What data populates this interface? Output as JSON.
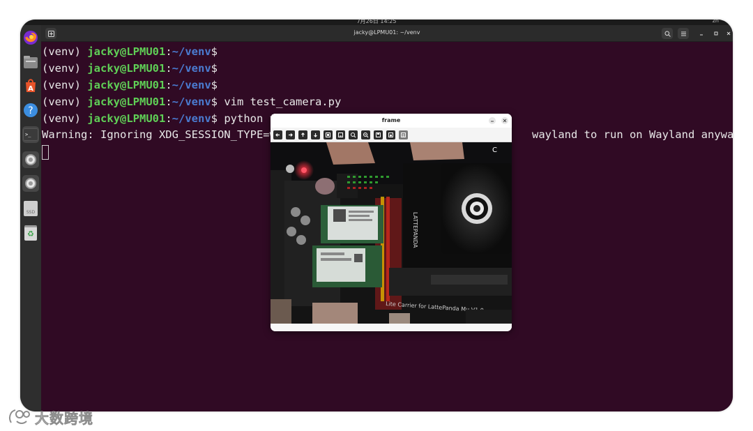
{
  "topbar": {
    "clock": "7月26日 14:25",
    "system": "zh"
  },
  "dock": {
    "items": [
      {
        "name": "firefox",
        "icon": "firefox-icon"
      },
      {
        "name": "files",
        "icon": "folder-icon"
      },
      {
        "name": "software",
        "icon": "app-center-icon"
      },
      {
        "name": "help",
        "icon": "help-icon",
        "glyph": "?"
      },
      {
        "name": "terminal",
        "icon": "terminal-icon",
        "glyph": ">_"
      },
      {
        "name": "settings-1",
        "icon": "gear-icon"
      },
      {
        "name": "settings-2",
        "icon": "gear-icon"
      },
      {
        "name": "ssd",
        "icon": "drive-icon",
        "label": "SSD"
      },
      {
        "name": "trash",
        "icon": "trash-icon",
        "glyph": "♻"
      }
    ]
  },
  "terminal": {
    "title": "jacky@LPMU01: ~/venv",
    "prompt": {
      "venv": "(venv) ",
      "user": "jacky@LPMU01",
      "colon": ":",
      "path": "~/venv",
      "dollar": "$"
    },
    "lines": [
      {
        "cmd": ""
      },
      {
        "cmd": ""
      },
      {
        "cmd": ""
      },
      {
        "cmd": " vim test_camera.py"
      },
      {
        "cmd": " python t"
      }
    ],
    "warning_left": "Warning: Ignoring XDG_SESSION_TYPE=w",
    "warning_right": "wayland to run on Wayland anyway."
  },
  "frame_window": {
    "title": "frame",
    "tools": [
      "home-icon",
      "back-icon",
      "forward-icon",
      "pan-icon",
      "zoom-icon",
      "zoom-in-icon",
      "zoom-out-icon",
      "zoom-fit-icon",
      "save-icon",
      "copy-icon",
      "properties-icon",
      "config-icon"
    ],
    "board_text": "Lite Carrier for LattePanda Mu V1.0",
    "brand_text": "LATTEPANDA"
  },
  "watermark": {
    "text": "大数跨境"
  },
  "colors": {
    "terminal_bg": "#300a24",
    "user": "#5fcf56",
    "path": "#4a7bd0"
  }
}
